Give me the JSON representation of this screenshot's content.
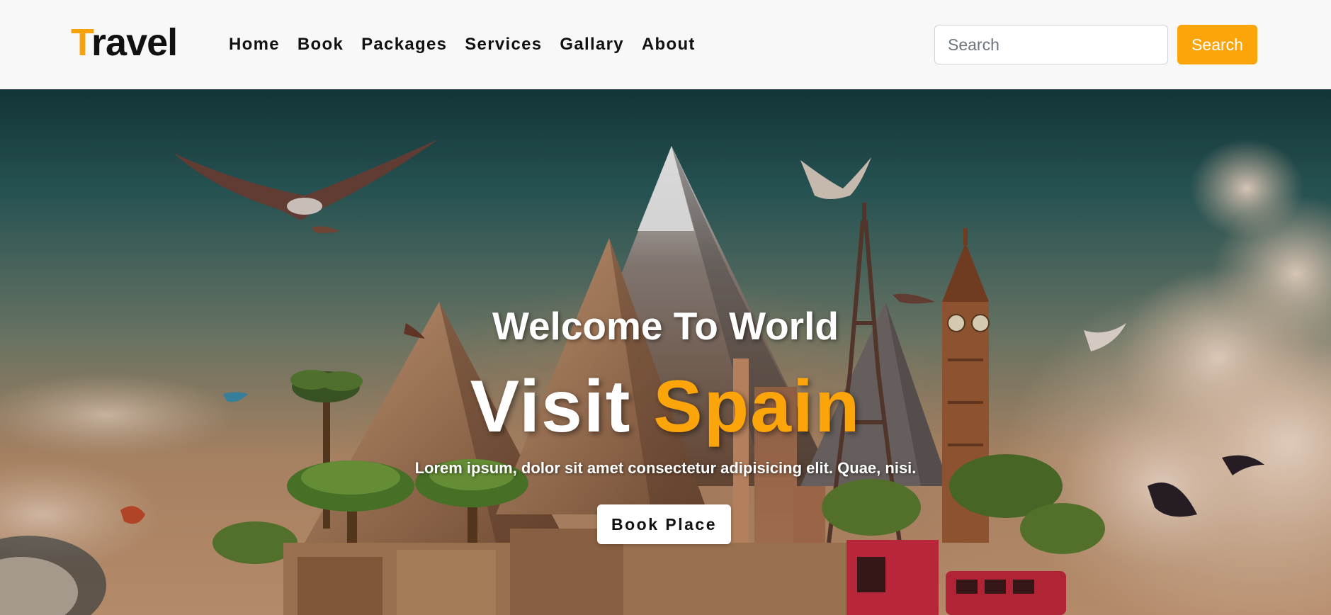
{
  "brand": {
    "first_letter": "T",
    "rest": "ravel"
  },
  "nav": {
    "items": [
      {
        "label": "Home"
      },
      {
        "label": "Book"
      },
      {
        "label": "Packages"
      },
      {
        "label": "Services"
      },
      {
        "label": "Gallary"
      },
      {
        "label": "About"
      }
    ]
  },
  "search": {
    "placeholder": "Search",
    "value": "",
    "button_label": "Search"
  },
  "hero": {
    "subtitle": "Welcome To World",
    "title_main": "Visit",
    "title_accent": "Spain",
    "description": "Lorem ipsum, dolor sit amet consectetur adipisicing elit. Quae, nisi.",
    "cta_label": "Book Place",
    "background_image": "travel-collage-landmarks"
  },
  "colors": {
    "accent": "#fca50a",
    "navbar_bg": "#f8f8f8",
    "text_dark": "#111111",
    "hero_text": "#ffffff"
  }
}
